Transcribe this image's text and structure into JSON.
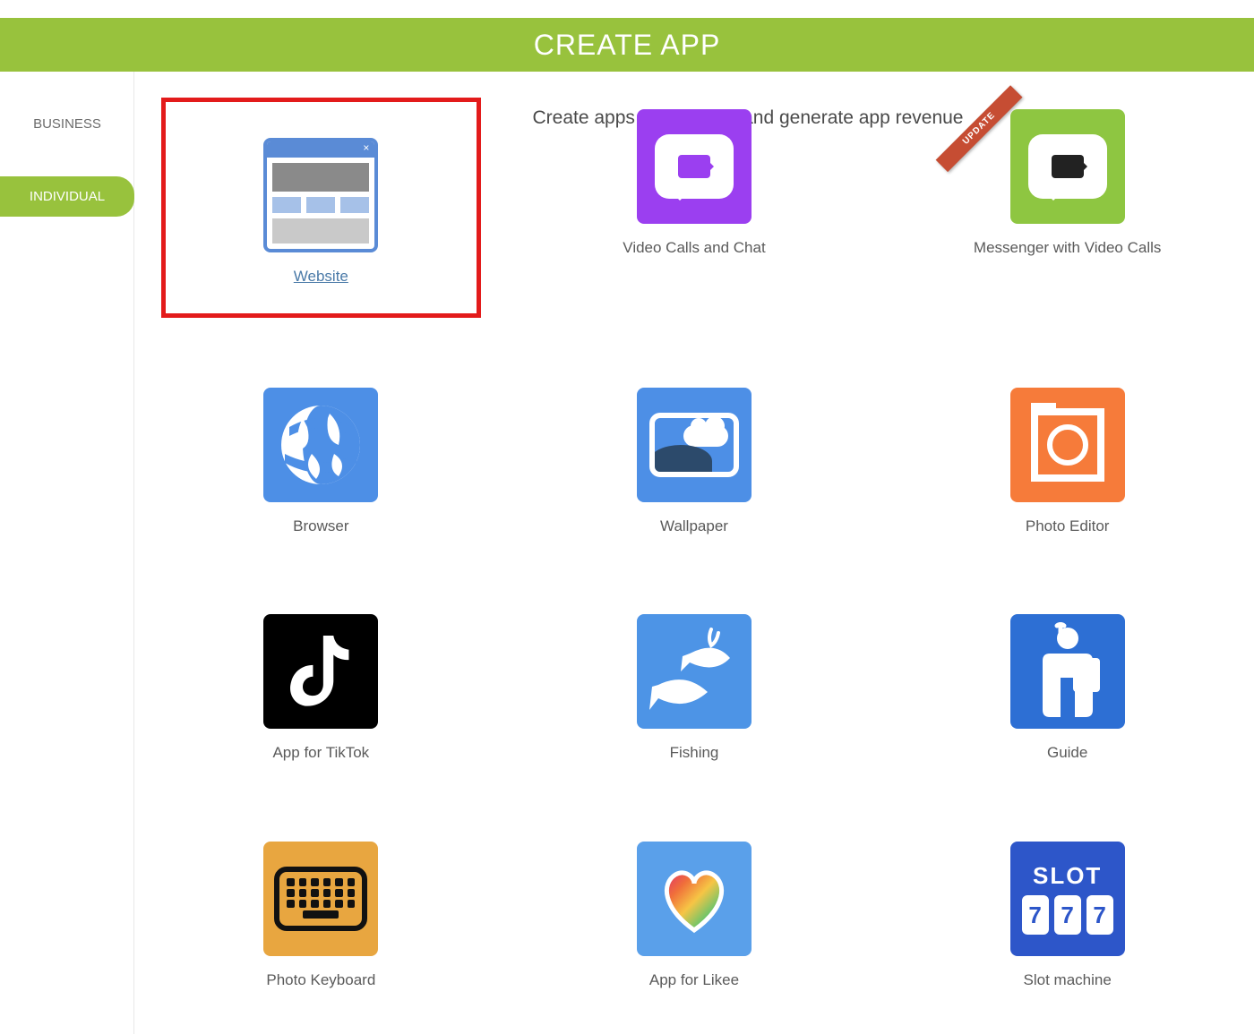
{
  "header": {
    "title": "CREATE APP"
  },
  "sidebar": {
    "items": [
      {
        "label": "BUSINESS",
        "active": false
      },
      {
        "label": "INDIVIDUAL",
        "active": true
      }
    ]
  },
  "content": {
    "intro": "Create apps to monetize and generate app revenue",
    "ribbon_update": "UPDATE",
    "slot_title": "SLOT",
    "slot_digit": "7",
    "apps": [
      {
        "label": "Website",
        "icon": "website",
        "selected": true,
        "badge": null
      },
      {
        "label": "Video Calls and Chat",
        "icon": "video",
        "selected": false,
        "badge": null
      },
      {
        "label": "Messenger with Video Calls",
        "icon": "messenger",
        "selected": false,
        "badge": "update"
      },
      {
        "label": "Browser",
        "icon": "browser",
        "selected": false,
        "badge": null
      },
      {
        "label": "Wallpaper",
        "icon": "wallpaper",
        "selected": false,
        "badge": null
      },
      {
        "label": "Photo Editor",
        "icon": "photoedit",
        "selected": false,
        "badge": null
      },
      {
        "label": "App for TikTok",
        "icon": "tiktok",
        "selected": false,
        "badge": null
      },
      {
        "label": "Fishing",
        "icon": "fishing",
        "selected": false,
        "badge": null
      },
      {
        "label": "Guide",
        "icon": "guide",
        "selected": false,
        "badge": null
      },
      {
        "label": "Photo Keyboard",
        "icon": "keyboard",
        "selected": false,
        "badge": null
      },
      {
        "label": "App for Likee",
        "icon": "likee",
        "selected": false,
        "badge": null
      },
      {
        "label": "Slot machine",
        "icon": "slot",
        "selected": false,
        "badge": null
      }
    ]
  }
}
